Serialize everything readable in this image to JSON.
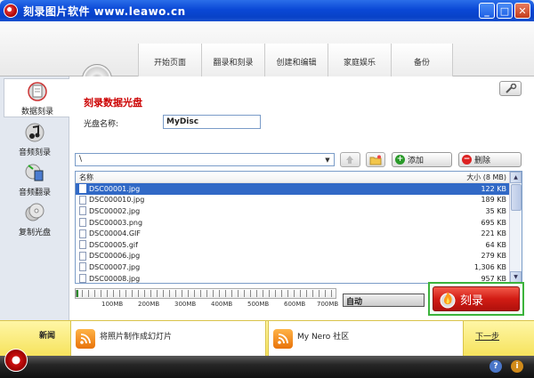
{
  "window": {
    "title": "刻录图片软件 www.leawo.cn",
    "controls": {
      "minimize": "_",
      "maximize": "□",
      "close": "✕"
    }
  },
  "nav_tabs": [
    "开始页面",
    "翻录和刻录",
    "创建和编辑",
    "家庭娱乐",
    "备份"
  ],
  "sidebar": {
    "items": [
      {
        "label": "数据刻录",
        "icon": "data-disc-icon",
        "active": true
      },
      {
        "label": "音频刻录",
        "icon": "music-note-icon",
        "active": false
      },
      {
        "label": "音频翻录",
        "icon": "audio-rip-icon",
        "active": false
      },
      {
        "label": "复制光盘",
        "icon": "copy-disc-icon",
        "active": false
      }
    ]
  },
  "main": {
    "heading": "刻录数据光盘",
    "disc_name_label": "光盘名称:",
    "disc_name_value": "MyDisc",
    "path_value": "\\",
    "add_label": "添加",
    "delete_label": "删除",
    "auto_label": "自动",
    "burn_label": "刻录"
  },
  "file_list": {
    "col_name": "名称",
    "col_size": "大小 (8 MB)",
    "rows": [
      {
        "name": "DSC00001.jpg",
        "size": "122 KB",
        "selected": true
      },
      {
        "name": "DSC000010.jpg",
        "size": "189 KB",
        "selected": false
      },
      {
        "name": "DSC00002.jpg",
        "size": "35 KB",
        "selected": false
      },
      {
        "name": "DSC00003.png",
        "size": "695 KB",
        "selected": false
      },
      {
        "name": "DSC00004.GIF",
        "size": "221 KB",
        "selected": false
      },
      {
        "name": "DSC00005.gif",
        "size": "64 KB",
        "selected": false
      },
      {
        "name": "DSC00006.jpg",
        "size": "279 KB",
        "selected": false
      },
      {
        "name": "DSC00007.jpg",
        "size": "1,306 KB",
        "selected": false
      },
      {
        "name": "DSC00008.jpg",
        "size": "957 KB",
        "selected": false
      }
    ]
  },
  "capacity": {
    "labels": [
      "100MB",
      "200MB",
      "300MB",
      "400MB",
      "500MB",
      "600MB",
      "700MB"
    ],
    "used_mb": 8
  },
  "bottom_bar": {
    "news_label": "新闻",
    "card1": "将照片制作成幻灯片",
    "card2": "My Nero 社区",
    "next_label": "下一步"
  },
  "status_bar": {
    "help": "?",
    "info": "i"
  },
  "colors": {
    "accent_red": "#cc0000",
    "selection_blue": "#3169c6",
    "burn_border": "#3cb33c",
    "bottom_yellow": "#f6e35d"
  }
}
